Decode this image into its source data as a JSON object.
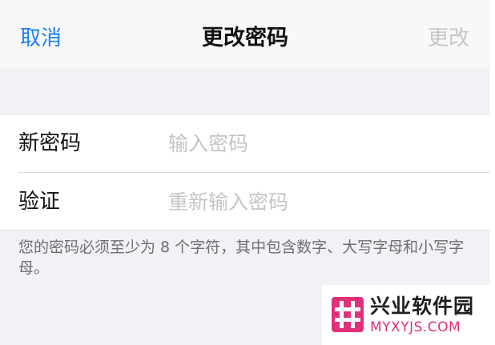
{
  "navbar": {
    "cancel_label": "取消",
    "title": "更改密码",
    "done_label": "更改"
  },
  "form": {
    "new_password": {
      "label": "新密码",
      "placeholder": "输入密码",
      "value": ""
    },
    "verify": {
      "label": "验证",
      "placeholder": "重新输入密码",
      "value": ""
    }
  },
  "footnote": "您的密码必须至少为 8 个字符，其中包含数字、大写字母和小写字母。",
  "watermark": {
    "logo_icon": "hash-logo-icon",
    "title": "兴业软件园",
    "subtitle": "MYXYJS.COM"
  },
  "colors": {
    "accent": "#1a7ff5",
    "disabled": "#c6c6c8",
    "placeholder": "#c4c4c7",
    "background": "#f2f2f6",
    "watermark_pink": "#e0307a"
  }
}
